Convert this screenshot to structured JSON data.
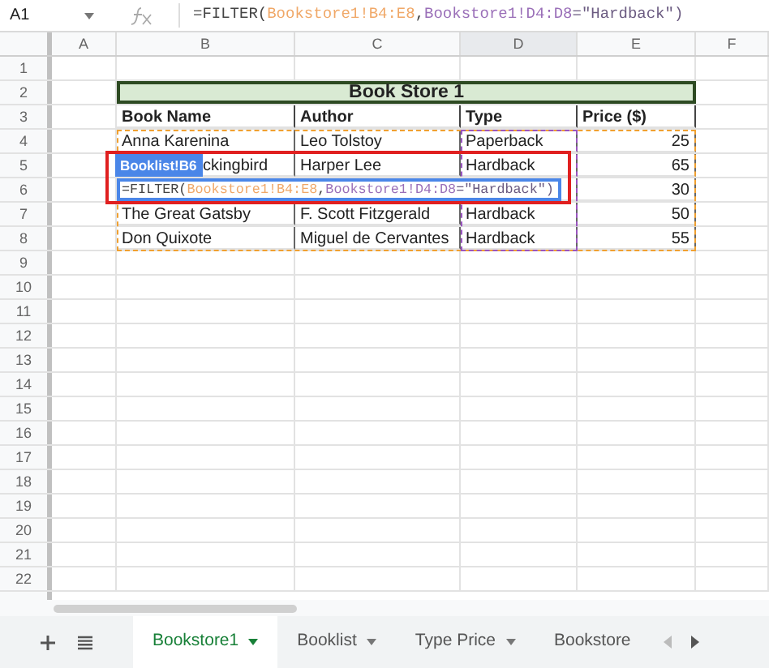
{
  "formula_bar": {
    "cell_ref": "A1",
    "formula": [
      {
        "text": "=FILTER(",
        "color": "#444444"
      },
      {
        "text": "Bookstore1!B4:E8",
        "color": "#f0a868"
      },
      {
        "text": ",",
        "color": "#444444"
      },
      {
        "text": "Bookstore1!D4:D8",
        "color": "#9a6fb8"
      },
      {
        "text": "=\"Hardback\")",
        "color": "#6a5a80"
      }
    ]
  },
  "columns": [
    {
      "label": "A",
      "selected": false
    },
    {
      "label": "B",
      "selected": false
    },
    {
      "label": "C",
      "selected": false
    },
    {
      "label": "D",
      "selected": true
    },
    {
      "label": "E",
      "selected": false
    },
    {
      "label": "F",
      "selected": false
    }
  ],
  "row_numbers": [
    "1",
    "2",
    "3",
    "4",
    "5",
    "6",
    "7",
    "8",
    "9",
    "10",
    "11",
    "12",
    "13",
    "14",
    "15",
    "16",
    "17",
    "18",
    "19",
    "20",
    "21",
    "22"
  ],
  "table": {
    "title": "Book Store 1",
    "headers": [
      "Book Name",
      "Author",
      "Type",
      "Price ($)"
    ],
    "rows": [
      [
        "Anna Karenina",
        "Leo Tolstoy",
        "Paperback",
        "25"
      ],
      [
        "ckingbird",
        "Harper Lee",
        "Hardback",
        "65"
      ],
      [
        null,
        null,
        null,
        "30"
      ],
      [
        "The Great Gatsby",
        "F. Scott Fitzgerald",
        "Hardback",
        "50"
      ],
      [
        "Don Quixote",
        "Miguel de Cervantes",
        "Hardback",
        "55"
      ]
    ]
  },
  "editor": {
    "tooltip": "Booklist!B6",
    "formula": [
      {
        "text": "=FILTER(",
        "color": "#444444"
      },
      {
        "text": "Bookstore1!B4:E8",
        "color": "#f0a868"
      },
      {
        "text": ",",
        "color": "#444444"
      },
      {
        "text": "Bookstore1!D4:D8",
        "color": "#9a6fb8"
      },
      {
        "text": "=\"Hardback\")",
        "color": "#6a5a80"
      }
    ]
  },
  "sheet_tabs": [
    {
      "label": "Bookstore1",
      "selected": true,
      "caret": true
    },
    {
      "label": "Booklist",
      "selected": false,
      "caret": true
    },
    {
      "label": "Type Price",
      "selected": false,
      "caret": true
    },
    {
      "label": "Bookstore",
      "selected": false,
      "caret": false
    }
  ]
}
